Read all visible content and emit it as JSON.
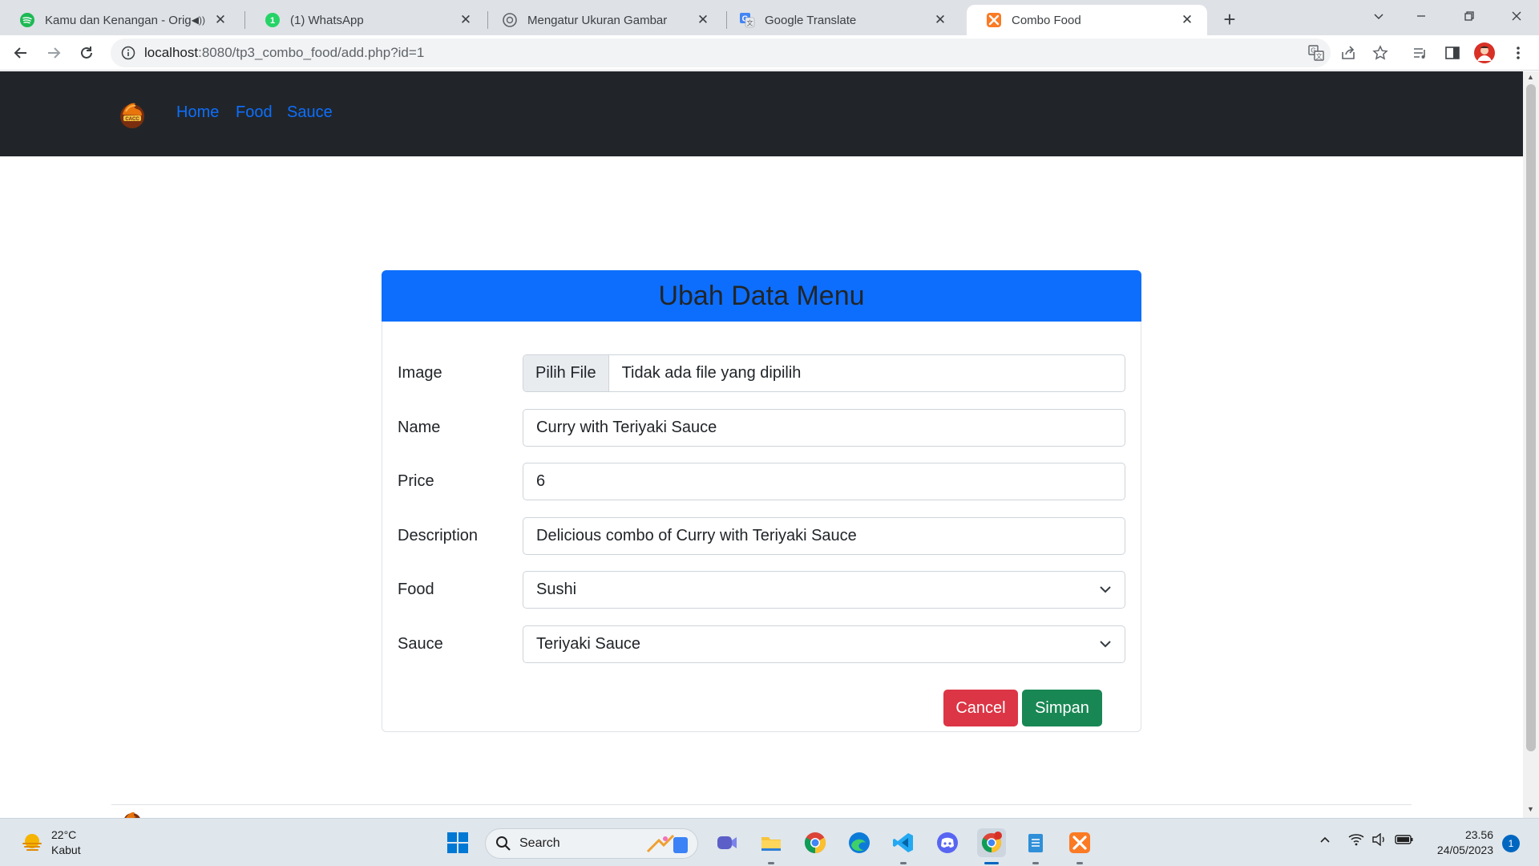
{
  "browser": {
    "tabs": [
      {
        "title": "Kamu dan Kenangan - Origin",
        "icon": "spotify-icon",
        "playing_audio": true
      },
      {
        "title": "(1) WhatsApp",
        "icon": "whatsapp-icon"
      },
      {
        "title": "Mengatur Ukuran Gambar",
        "icon": "chatgpt-icon"
      },
      {
        "title": "Google Translate",
        "icon": "google-translate-icon"
      },
      {
        "title": "Combo Food",
        "icon": "xampp-icon",
        "active": true
      }
    ],
    "url": {
      "host": "localhost",
      "rest": ":8080/tp3_combo_food/add.php?id=1"
    }
  },
  "navbar": {
    "links": [
      "Home",
      "Food",
      "Sauce"
    ]
  },
  "form": {
    "title": "Ubah Data Menu",
    "image": {
      "label": "Image",
      "button": "Pilih File",
      "status": "Tidak ada file yang dipilih"
    },
    "name": {
      "label": "Name",
      "value": "Curry with Teriyaki Sauce"
    },
    "price": {
      "label": "Price",
      "value": "6"
    },
    "description": {
      "label": "Description",
      "value": "Delicious combo of Curry with Teriyaki Sauce"
    },
    "food": {
      "label": "Food",
      "selected": "Sushi"
    },
    "sauce": {
      "label": "Sauce",
      "selected": "Teriyaki Sauce"
    },
    "cancel_label": "Cancel",
    "save_label": "Simpan"
  },
  "colors": {
    "primary": "#0d6efd",
    "danger": "#dc3545",
    "success": "#198754",
    "navbar": "#212529"
  },
  "taskbar": {
    "weather": {
      "temp": "22°C",
      "desc": "Kabut"
    },
    "search_label": "Search",
    "time": "23.56",
    "date": "24/05/2023",
    "notifications": "1"
  }
}
